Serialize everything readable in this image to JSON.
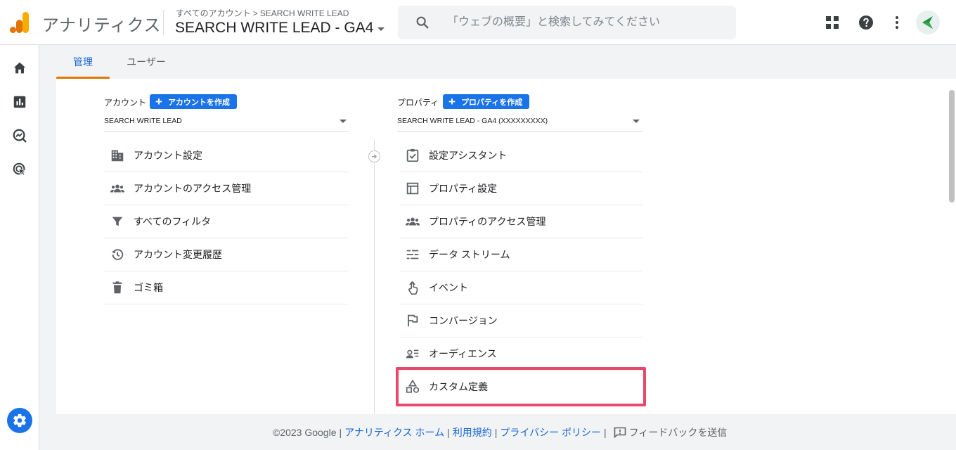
{
  "app": {
    "name": "アナリティクス",
    "breadcrumb_root": "すべてのアカウント",
    "breadcrumb_sep": ">",
    "breadcrumb_account": "SEARCH WRITE LEAD",
    "property_title": "SEARCH WRITE LEAD - GA4"
  },
  "search": {
    "placeholder": "「ウェブの概要」と検索してみてください"
  },
  "header_icons": [
    "apps-grid-icon",
    "help-icon",
    "more-vert-icon",
    "account-avatar-icon"
  ],
  "leftnav": {
    "items": [
      "home-icon",
      "reports-icon",
      "explore-icon",
      "advertising-icon"
    ],
    "settings": "settings-gear-icon"
  },
  "tabs": [
    {
      "label": "管理",
      "active": true
    },
    {
      "label": "ユーザー",
      "active": false
    }
  ],
  "account_column": {
    "label": "アカウント",
    "create_label": "アカウントを作成",
    "selected": "SEARCH WRITE LEAD",
    "items": [
      {
        "label": "アカウント設定",
        "icon": "building-icon"
      },
      {
        "label": "アカウントのアクセス管理",
        "icon": "people-icon"
      },
      {
        "label": "すべてのフィルタ",
        "icon": "filter-icon"
      },
      {
        "label": "アカウント変更履歴",
        "icon": "history-icon"
      },
      {
        "label": "ゴミ箱",
        "icon": "trash-icon"
      }
    ]
  },
  "property_column": {
    "label": "プロパティ",
    "create_label": "プロパティを作成",
    "selected": "SEARCH WRITE LEAD - GA4 (XXXXXXXXX)",
    "items": [
      {
        "label": "設定アシスタント",
        "icon": "checklist-icon"
      },
      {
        "label": "プロパティ設定",
        "icon": "web-window-icon"
      },
      {
        "label": "プロパティのアクセス管理",
        "icon": "people-icon"
      },
      {
        "label": "データ ストリーム",
        "icon": "stream-icon"
      },
      {
        "label": "イベント",
        "icon": "touch-icon"
      },
      {
        "label": "コンバージョン",
        "icon": "flag-icon"
      },
      {
        "label": "オーディエンス",
        "icon": "audience-icon"
      },
      {
        "label": "カスタム定義",
        "icon": "shapes-icon",
        "highlighted": true
      }
    ]
  },
  "footer": {
    "copyright": "©2023 Google",
    "sep": "|",
    "link_home": "アナリティクス ホーム",
    "link_terms": "利用規約",
    "link_privacy": "プライバシー ポリシー",
    "feedback": "フィードバックを送信"
  },
  "colors": {
    "accent_blue": "#1a73e8",
    "tab_underline": "#e37400",
    "highlight_border": "#e8486b",
    "logo_orange": "#f9ab00",
    "logo_dark_orange": "#e37400"
  }
}
